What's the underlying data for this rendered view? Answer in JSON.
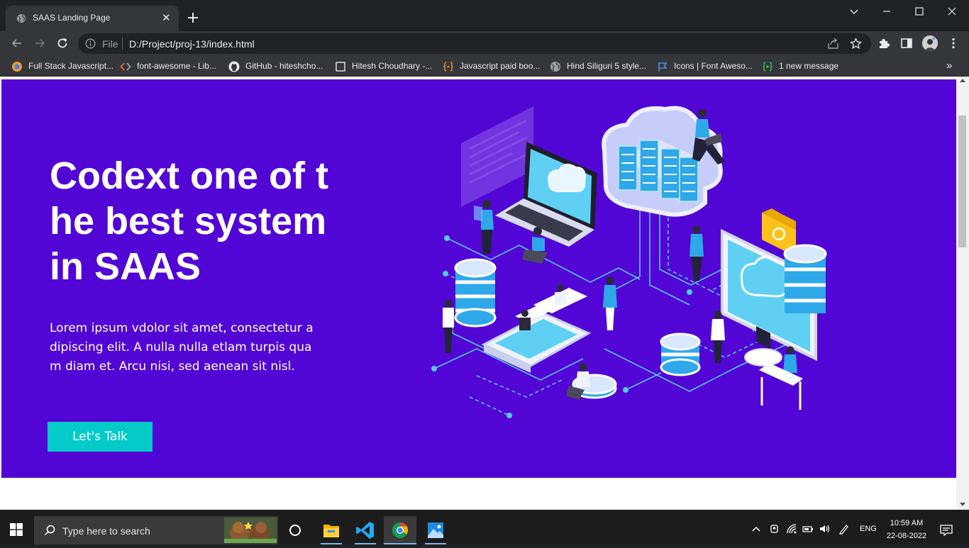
{
  "browser": {
    "tab": {
      "title": "SAAS Landing Page",
      "close_glyph": "✕",
      "favicon": "globe-icon"
    },
    "omnibox": {
      "scheme_label": "File",
      "url": "D:/Project/proj-13/index.html"
    },
    "bookmarks": [
      {
        "label": "Full Stack Javascript...",
        "icon": "orange-circle-icon"
      },
      {
        "label": "font-awesome - Lib...",
        "icon": "code-brackets-icon"
      },
      {
        "label": "GitHub - hiteshcho...",
        "icon": "github-icon"
      },
      {
        "label": "Hitesh Choudhary -...",
        "icon": "page-icon"
      },
      {
        "label": "Javascript paid boo...",
        "icon": "braces-icon"
      },
      {
        "label": "Hind Siliguri 5 style...",
        "icon": "globe-icon"
      },
      {
        "label": "Icons | Font Aweso...",
        "icon": "flag-icon"
      },
      {
        "label": "1 new message",
        "icon": "chat-icon"
      }
    ],
    "bookmarks_more": "»"
  },
  "page": {
    "hero": {
      "title": "Codext one of the best system in SAAS",
      "description": "Lorem ipsum vdolor sit amet, consectetur adipiscing elit. A nulla nulla etlam turpis quam diam et. Arcu nisi, sed aenean sit nisl.",
      "cta_label": "Let's Talk",
      "background_color": "#5206d6",
      "cta_color": "#04cac8"
    }
  },
  "taskbar": {
    "search_placeholder": "Type here to search",
    "apps": [
      "file-explorer-icon",
      "vscode-icon",
      "chrome-icon",
      "photos-icon"
    ],
    "language": "ENG",
    "time": "10:59 AM",
    "date": "22-08-2022"
  }
}
